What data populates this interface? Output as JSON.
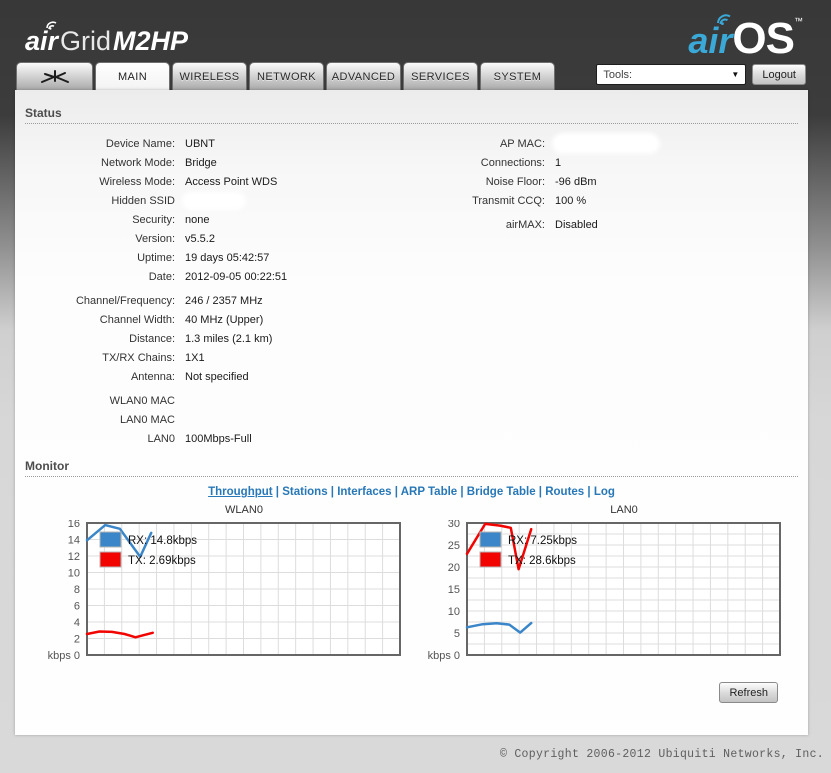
{
  "header": {
    "device_logo": {
      "air": "air",
      "grid": "Grid",
      "model": "M2HP"
    },
    "os_logo": {
      "air": "air",
      "os": "OS",
      "tm": "TM"
    },
    "tools_label": "Tools:",
    "logout_label": "Logout"
  },
  "tabs": [
    {
      "label": "",
      "icon": "ubnt-antenna-logo",
      "active": false
    },
    {
      "label": "MAIN",
      "active": true
    },
    {
      "label": "WIRELESS",
      "active": false
    },
    {
      "label": "NETWORK",
      "active": false
    },
    {
      "label": "ADVANCED",
      "active": false
    },
    {
      "label": "SERVICES",
      "active": false
    },
    {
      "label": "SYSTEM",
      "active": false
    }
  ],
  "status": {
    "heading": "Status",
    "left_groups": [
      [
        {
          "label": "Device Name:",
          "value": "UBNT"
        },
        {
          "label": "Network Mode:",
          "value": "Bridge"
        },
        {
          "label": "Wireless Mode:",
          "value": "Access Point WDS"
        },
        {
          "label": "Hidden SSID",
          "value": "",
          "redacted": "ssid"
        },
        {
          "label": "Security:",
          "value": "none"
        },
        {
          "label": "Version:",
          "value": "v5.5.2"
        },
        {
          "label": "Uptime:",
          "value": "19 days 05:42:57"
        },
        {
          "label": "Date:",
          "value": "2012-09-05 00:22:51"
        }
      ],
      [
        {
          "label": "Channel/Frequency:",
          "value": "246 / 2357 MHz"
        },
        {
          "label": "Channel Width:",
          "value": "40 MHz (Upper)"
        },
        {
          "label": "Distance:",
          "value": "1.3 miles (2.1 km)"
        },
        {
          "label": "TX/RX Chains:",
          "value": "1X1"
        },
        {
          "label": "Antenna:",
          "value": "Not specified"
        }
      ],
      [
        {
          "label": "WLAN0 MAC",
          "value": ""
        },
        {
          "label": "LAN0 MAC",
          "value": ""
        },
        {
          "label": "LAN0",
          "value": "100Mbps-Full"
        }
      ]
    ],
    "right_groups": [
      [
        {
          "label": "AP MAC:",
          "value": "",
          "redacted": "mac"
        },
        {
          "label": "Connections:",
          "value": "1"
        },
        {
          "label": "Noise Floor:",
          "value": "-96 dBm"
        },
        {
          "label": "Transmit CCQ:",
          "value": "100 %"
        }
      ],
      [
        {
          "label": "airMAX:",
          "value": "Disabled"
        }
      ]
    ]
  },
  "monitor": {
    "heading": "Monitor",
    "links": [
      {
        "label": "Throughput",
        "active": true
      },
      {
        "label": "Stations",
        "active": false
      },
      {
        "label": "Interfaces",
        "active": false
      },
      {
        "label": "ARP Table",
        "active": false
      },
      {
        "label": "Bridge Table",
        "active": false
      },
      {
        "label": "Routes",
        "active": false
      },
      {
        "label": "Log",
        "active": false
      }
    ],
    "separator": " | ",
    "refresh_label": "Refresh"
  },
  "chart_data": [
    {
      "type": "line",
      "title": "WLAN0",
      "ylabel": "kbps",
      "origin_label": "kbps 0",
      "ylim": [
        0,
        16
      ],
      "ytick_step": 2,
      "ygrid_step": 2,
      "xgrid_count": 18,
      "grid": true,
      "legend_position": "top-left",
      "series": [
        {
          "name": "RX",
          "label": "RX: 14.8kbps",
          "color": "#3a86c8",
          "x": [
            0,
            0.058,
            0.105,
            0.17,
            0.205
          ],
          "y": [
            13.9,
            15.75,
            15.3,
            11.9,
            14.8
          ]
        },
        {
          "name": "TX",
          "label": "TX: 2.69kbps",
          "color": "#f20400",
          "x": [
            0,
            0.04,
            0.08,
            0.12,
            0.155,
            0.185,
            0.21
          ],
          "y": [
            2.55,
            2.85,
            2.8,
            2.55,
            2.15,
            2.45,
            2.69
          ]
        }
      ]
    },
    {
      "type": "line",
      "title": "LAN0",
      "ylabel": "kbps",
      "origin_label": "kbps 0",
      "ylim": [
        0,
        30
      ],
      "ytick_step": 5,
      "ygrid_step": 2.5,
      "xgrid_count": 18,
      "grid": true,
      "legend_position": "top-left",
      "series": [
        {
          "name": "RX",
          "label": "RX: 7.25kbps",
          "color": "#3a86c8",
          "x": [
            0,
            0.05,
            0.095,
            0.135,
            0.17,
            0.205
          ],
          "y": [
            6.3,
            7.0,
            7.2,
            6.9,
            5.1,
            7.25
          ]
        },
        {
          "name": "TX",
          "label": "TX: 28.6kbps",
          "color": "#f20400",
          "x": [
            0,
            0.058,
            0.105,
            0.14,
            0.165,
            0.205
          ],
          "y": [
            23.0,
            29.8,
            29.4,
            28.9,
            19.5,
            28.6
          ]
        }
      ]
    }
  ],
  "colors": {
    "link_blue": "#2878b8",
    "chart_blue": "#3a86c8",
    "chart_red": "#f20400",
    "grid_line": "#dddddd",
    "chart_border": "#666666"
  },
  "footer": {
    "copyright": "© Copyright 2006-2012 Ubiquiti Networks, Inc."
  }
}
